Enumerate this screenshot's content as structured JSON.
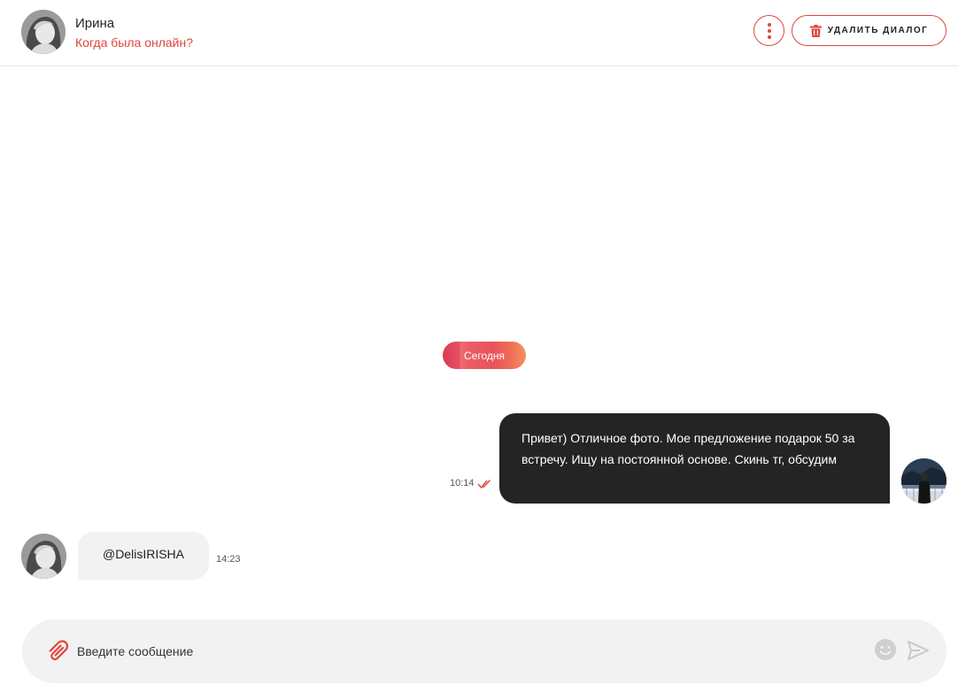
{
  "header": {
    "contact_name": "Ирина",
    "contact_status": "Когда была онлайн?",
    "delete_label": "УДАЛИТЬ ДИАЛОГ",
    "menu_icon": "more-vertical-icon",
    "trash_icon": "trash-icon"
  },
  "chat": {
    "date_separator": "Сегодня",
    "messages": [
      {
        "direction": "outgoing",
        "text": "Привет) Отличное фото. Мое предложение подарок 50 за встречу. Ищу на постоянной основе. Скинь тг, обсудим",
        "time": "10:14",
        "status": "read"
      },
      {
        "direction": "incoming",
        "text": "@DelisIRISHA",
        "time": "14:23"
      }
    ]
  },
  "composer": {
    "placeholder": "Введите сообщение",
    "value": ""
  },
  "colors": {
    "accent": "#e0453c",
    "outgoing_bubble": "#242424",
    "incoming_bubble": "#f2f2f2",
    "composer_bg": "#f2f2f2"
  }
}
